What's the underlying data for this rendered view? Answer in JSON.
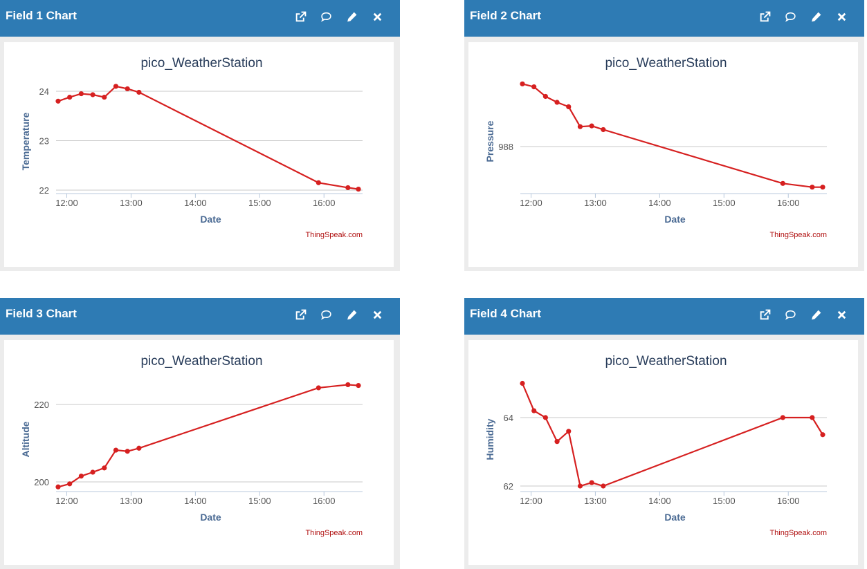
{
  "panels": [
    {
      "title": "Field 1 Chart",
      "icons": [
        "external-link-icon",
        "comment-icon",
        "pencil-icon",
        "close-icon"
      ]
    },
    {
      "title": "Field 2 Chart",
      "icons": [
        "external-link-icon",
        "comment-icon",
        "pencil-icon",
        "close-icon"
      ]
    },
    {
      "title": "Field 3 Chart",
      "icons": [
        "external-link-icon",
        "comment-icon",
        "pencil-icon",
        "close-icon"
      ]
    },
    {
      "title": "Field 4 Chart",
      "icons": [
        "external-link-icon",
        "comment-icon",
        "pencil-icon",
        "close-icon"
      ]
    }
  ],
  "colors": {
    "header": "#2e7bb4",
    "series": "#d62020",
    "axis_label": "#4a6a93",
    "title": "#283c5a",
    "credits": "#b01010"
  },
  "chart_data": [
    {
      "type": "line",
      "title": "pico_WeatherStation",
      "xlabel": "Date",
      "ylabel": "Temperature",
      "credits": "ThingSpeak.com",
      "x_ticks": [
        "12:00",
        "13:00",
        "14:00",
        "15:00",
        "16:00"
      ],
      "y_ticks": [
        "22",
        "23",
        "24"
      ],
      "ylim": [
        22,
        24
      ],
      "grid": true,
      "series": [
        {
          "x": [
            "11:50",
            "12:01",
            "12:12",
            "12:23",
            "12:34",
            "12:45",
            "12:56",
            "13:07",
            "15:58",
            "16:26",
            "16:36"
          ],
          "values": [
            23.8,
            23.88,
            23.95,
            23.93,
            23.88,
            24.1,
            24.05,
            23.98,
            22.15,
            22.05,
            22.02
          ]
        }
      ]
    },
    {
      "type": "line",
      "title": "pico_WeatherStation",
      "xlabel": "Date",
      "ylabel": "Pressure",
      "credits": "ThingSpeak.com",
      "x_ticks": [
        "12:00",
        "13:00",
        "14:00",
        "15:00",
        "16:00"
      ],
      "y_ticks": [
        "988"
      ],
      "grid": true,
      "series": [
        {
          "x": [
            "11:50",
            "12:01",
            "12:12",
            "12:23",
            "12:34",
            "12:45",
            "12:56",
            "13:07",
            "15:58",
            "16:26",
            "16:36"
          ],
          "values": [
            988.85,
            988.81,
            988.68,
            988.6,
            988.54,
            988.27,
            988.28,
            988.23,
            987.5,
            987.45,
            987.45
          ]
        }
      ]
    },
    {
      "type": "line",
      "title": "pico_WeatherStation",
      "xlabel": "Date",
      "ylabel": "Altitude",
      "credits": "ThingSpeak.com",
      "x_ticks": [
        "12:00",
        "13:00",
        "14:00",
        "15:00",
        "16:00"
      ],
      "y_ticks": [
        "200",
        "220"
      ],
      "ylim": [
        200,
        220
      ],
      "grid": true,
      "series": [
        {
          "x": [
            "11:50",
            "12:01",
            "12:12",
            "12:23",
            "12:34",
            "12:45",
            "12:56",
            "13:07",
            "15:58",
            "16:26",
            "16:36"
          ],
          "values": [
            198.7,
            199.5,
            201.5,
            202.5,
            203.6,
            208.2,
            207.9,
            208.7,
            224.3,
            225.1,
            224.9
          ]
        }
      ]
    },
    {
      "type": "line",
      "title": "pico_WeatherStation",
      "xlabel": "Date",
      "ylabel": "Humidity",
      "credits": "ThingSpeak.com",
      "x_ticks": [
        "12:00",
        "13:00",
        "14:00",
        "15:00",
        "16:00"
      ],
      "y_ticks": [
        "62",
        "64"
      ],
      "ylim": [
        62,
        64
      ],
      "grid": true,
      "series": [
        {
          "x": [
            "11:50",
            "12:01",
            "12:12",
            "12:23",
            "12:34",
            "12:45",
            "12:56",
            "13:07",
            "15:58",
            "16:26",
            "16:36"
          ],
          "values": [
            65.0,
            64.2,
            64.0,
            63.3,
            63.6,
            62.0,
            62.1,
            62.0,
            64.0,
            64.0,
            63.5
          ]
        }
      ]
    }
  ]
}
